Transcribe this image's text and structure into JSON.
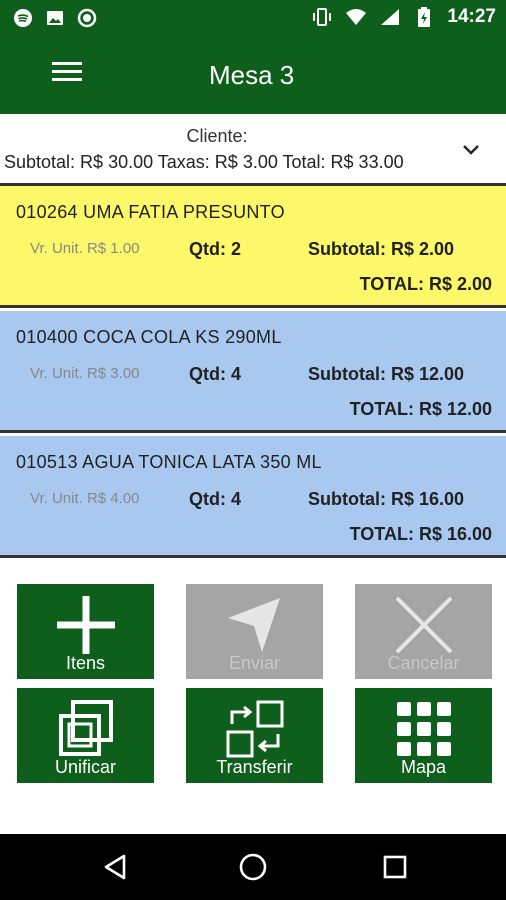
{
  "statusbar": {
    "time": "14:27"
  },
  "appbar": {
    "title": "Mesa 3"
  },
  "summary": {
    "cliente": "Cliente:",
    "totals": "Subtotal: R$ 30.00 Taxas: R$ 3.00 Total: R$ 33.00"
  },
  "items": [
    {
      "name": "010264 UMA FATIA PRESUNTO",
      "vunit": "Vr. Unit. R$ 1.00",
      "qtd": "Qtd: 2",
      "subtotal": "Subtotal: R$ 2.00",
      "total": "TOTAL: R$ 2.00",
      "color": "#fcf86a"
    },
    {
      "name": "010400 COCA COLA KS 290ML",
      "vunit": "Vr. Unit. R$ 3.00",
      "qtd": "Qtd: 4",
      "subtotal": "Subtotal: R$ 12.00",
      "total": "TOTAL: R$ 12.00",
      "color": "#a8c8f0"
    },
    {
      "name": "010513 AGUA TONICA LATA 350 ML",
      "vunit": "Vr. Unit. R$ 4.00",
      "qtd": "Qtd: 4",
      "subtotal": "Subtotal: R$ 16.00",
      "total": "TOTAL: R$ 16.00",
      "color": "#a8c8f0"
    }
  ],
  "actions": {
    "itens": "Itens",
    "enviar": "Enviar",
    "cancelar": "Cancelar",
    "unificar": "Unificar",
    "transferir": "Transferir",
    "mapa": "Mapa"
  },
  "colors": {
    "primary": "#0e5e1c",
    "disabled": "#a5a5a5",
    "yellow_row": "#fcf86a",
    "blue_row": "#a8c8f0"
  }
}
